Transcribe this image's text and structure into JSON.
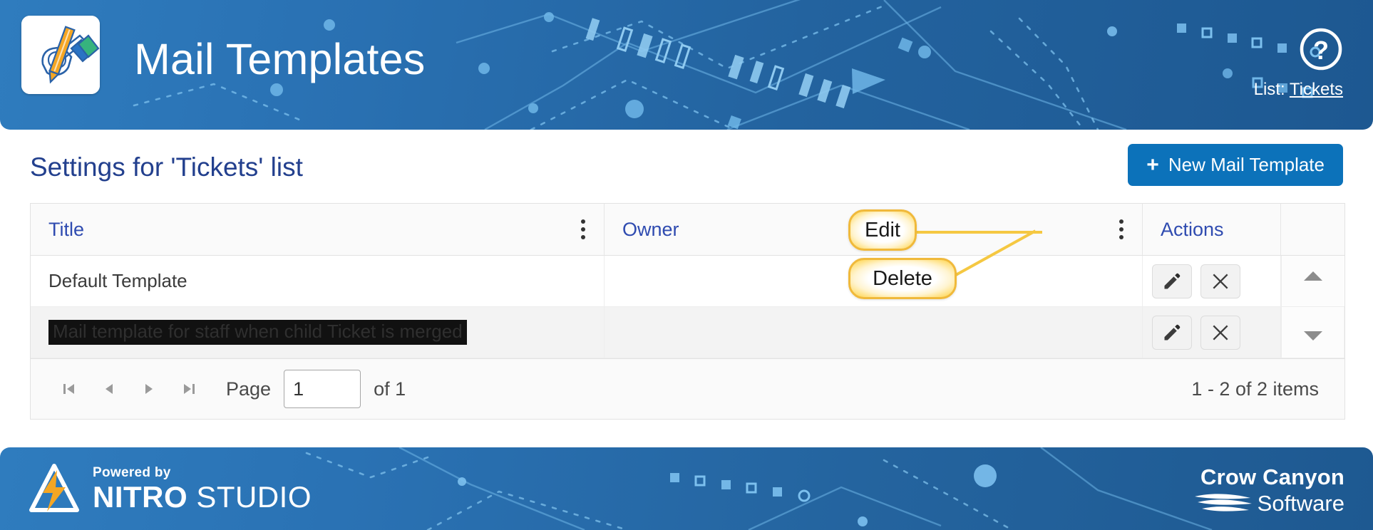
{
  "header": {
    "app_icon_name": "pencil-writing-icon",
    "title": "Mail Templates",
    "help_icon": "question-mark-circle-icon",
    "list_prefix": "List:",
    "list_name": "Tickets"
  },
  "main": {
    "section_title": "Settings for 'Tickets' list",
    "new_button": {
      "plus": "+",
      "label": "New Mail Template"
    },
    "grid": {
      "columns": [
        {
          "label": "Title",
          "menu_icon": "kebab-menu-icon"
        },
        {
          "label": "Owner",
          "menu_icon": "kebab-menu-icon"
        },
        {
          "label": "Actions",
          "menu_icon": null
        }
      ],
      "rows": [
        {
          "title": "Default Template",
          "owner": "",
          "highlighted": false
        },
        {
          "title": "Mail template for staff when child Ticket is merged",
          "owner": "",
          "highlighted": true
        }
      ],
      "row_actions": {
        "edit_icon": "pencil-icon",
        "delete_icon": "close-x-icon"
      },
      "scrollbar": {
        "up_icon": "triangle-up-icon",
        "down_icon": "triangle-down-icon"
      }
    },
    "pager": {
      "first_icon": "first-page-icon",
      "prev_icon": "previous-page-icon",
      "next_icon": "next-page-icon",
      "last_icon": "last-page-icon",
      "page_label": "Page",
      "page_value": "1",
      "of_label": "of 1",
      "items_label": "1 - 2 of 2 items"
    }
  },
  "callouts": [
    {
      "label": "Edit"
    },
    {
      "label": "Delete"
    }
  ],
  "footer": {
    "nitro_powered": "Powered by",
    "nitro_bold": "NITRO",
    "nitro_light": " STUDIO",
    "crow_top": "Crow Canyon",
    "crow_bottom": "Software"
  },
  "colors": {
    "banner_blue": "#2a72b4",
    "button_blue": "#0c72ba",
    "title_navy": "#23408e",
    "header_text_blue": "#2f4bb0",
    "callout_yellow": "#f0b93b"
  }
}
